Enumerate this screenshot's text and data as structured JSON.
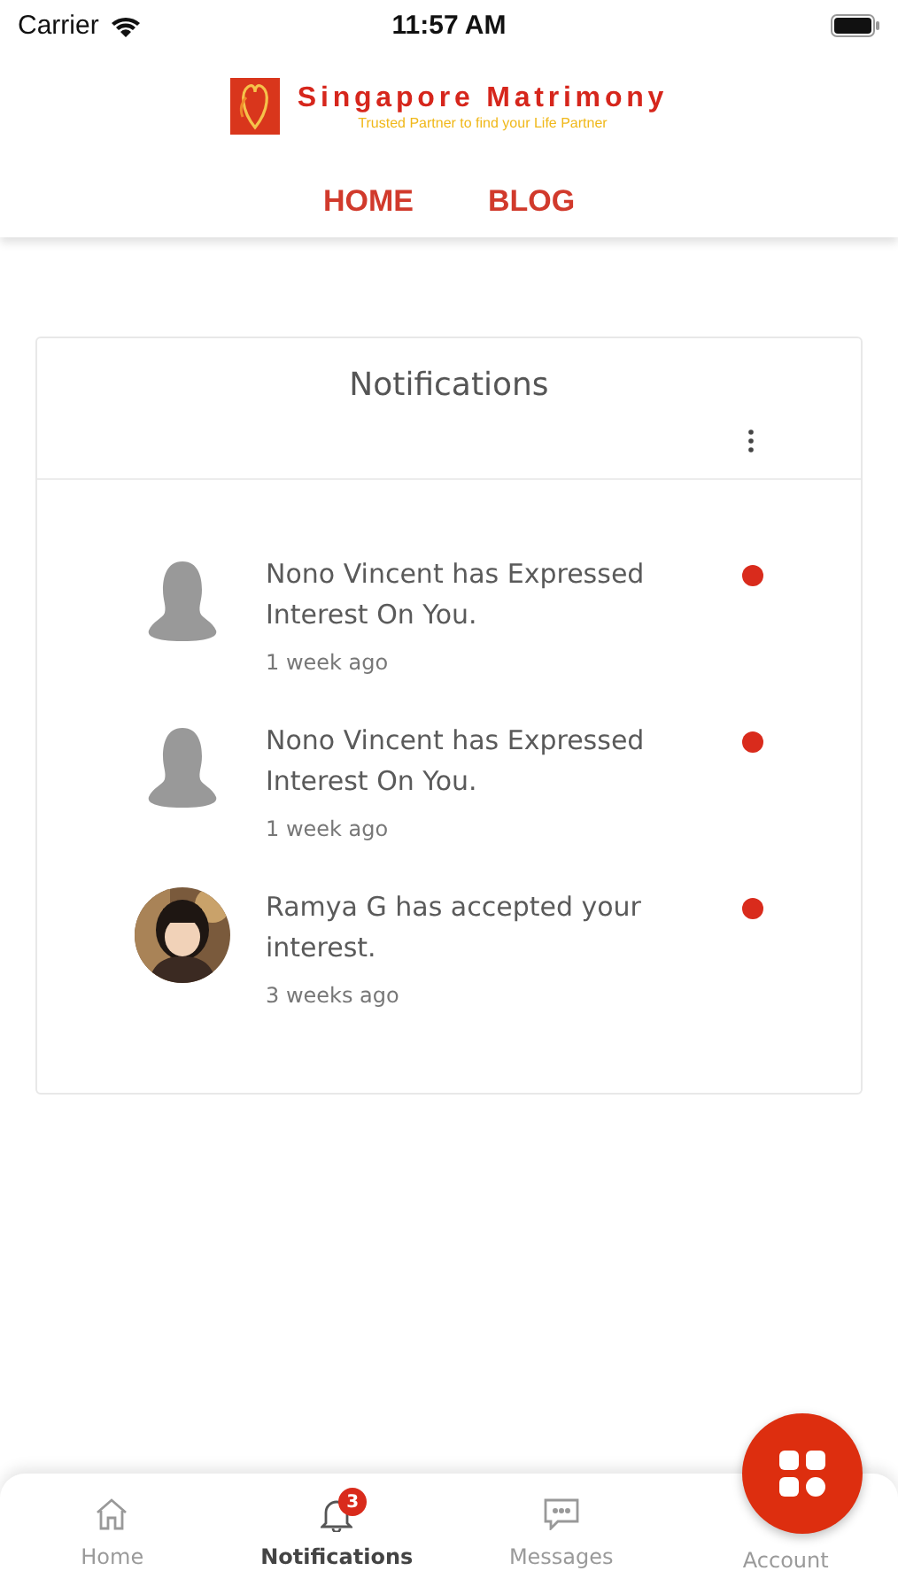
{
  "status_bar": {
    "carrier": "Carrier",
    "time": "11:57 AM"
  },
  "logo": {
    "name": "Singapore Matrimony",
    "tagline": "Trusted Partner to find your Life Partner"
  },
  "nav": [
    {
      "label": "HOME"
    },
    {
      "label": "BLOG"
    }
  ],
  "card": {
    "title": "Notifications",
    "notifications": [
      {
        "kind": "silhouette",
        "message": "Nono Vincent has Expressed Interest On You.",
        "time": "1 week ago",
        "unread": true
      },
      {
        "kind": "silhouette",
        "message": "Nono Vincent has Expressed Interest On You.",
        "time": "1 week ago",
        "unread": true
      },
      {
        "kind": "picture",
        "message": "Ramya G has accepted your interest.",
        "time": "3 weeks ago",
        "unread": true
      }
    ]
  },
  "tab_bar": [
    {
      "label": "Home",
      "kind": "home",
      "selected": false
    },
    {
      "label": "Notifications",
      "kind": "bell",
      "selected": true,
      "badge": "3"
    },
    {
      "label": "Messages",
      "kind": "message",
      "selected": false
    },
    {
      "label": "Account",
      "kind": "plain",
      "selected": false
    }
  ]
}
